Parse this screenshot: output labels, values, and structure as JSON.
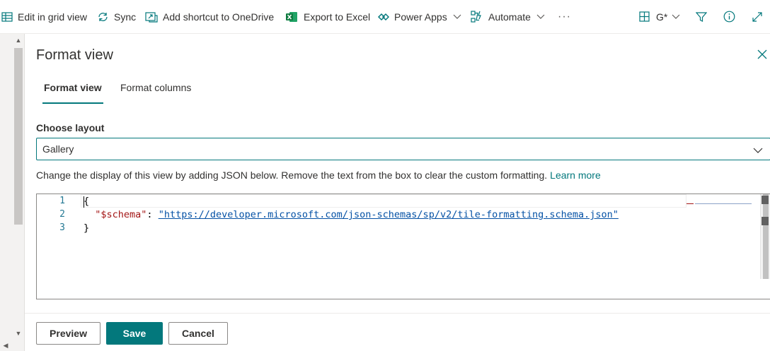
{
  "commandbar": {
    "items": [
      {
        "icon": "grid-icon",
        "label": "Edit in grid view"
      },
      {
        "icon": "sync-icon",
        "label": "Sync"
      },
      {
        "icon": "shortcut-icon",
        "label": "Add shortcut to OneDrive"
      },
      {
        "icon": "excel-icon",
        "label": "Export to Excel"
      },
      {
        "icon": "power-apps-icon",
        "label": "Power Apps"
      },
      {
        "icon": "automate-icon",
        "label": "Automate"
      }
    ],
    "more_glyph": "···",
    "view_switcher_label": "G*",
    "accent_excel": "#217346"
  },
  "panel": {
    "title": "Format view",
    "tabs": [
      {
        "label": "Format view",
        "active": true
      },
      {
        "label": "Format columns",
        "active": false
      }
    ],
    "layout_label": "Choose layout",
    "layout_value": "Gallery",
    "help_text": "Change the display of this view by adding JSON below. Remove the text from the box to clear the custom formatting.",
    "learn_more": "Learn more",
    "editor": {
      "line_numbers": [
        "1",
        "2",
        "3"
      ],
      "open_brace": "{",
      "schema_key": "\"$schema\"",
      "colon": ": ",
      "schema_value": "\"https://developer.microsoft.com/json-schemas/sp/v2/tile-formatting.schema.json\"",
      "close_brace": "}"
    },
    "buttons": {
      "preview": "Preview",
      "save": "Save",
      "cancel": "Cancel"
    }
  },
  "colors": {
    "accent": "#03787c",
    "text": "#323130",
    "border": "#8a8886"
  }
}
